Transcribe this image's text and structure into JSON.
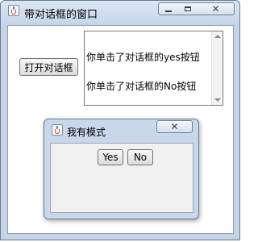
{
  "main_window": {
    "title": "带对话框的窗口",
    "app_icon": "java-cup-icon",
    "controls": {
      "minimize_icon": "minimize-icon",
      "maximize_icon": "maximize-icon",
      "close_icon": "close-icon",
      "close_glyph": "✕"
    },
    "open_dialog_button": "打开对话框",
    "log_lines": [
      "你单击了对话框的yes按钮",
      "你单击了对话框的No按钮"
    ]
  },
  "dialog": {
    "title": "我有模式",
    "app_icon": "java-cup-icon",
    "close_glyph": "✕",
    "yes_label": "Yes",
    "no_label": "No"
  },
  "colors": {
    "window_frame": "#c4d3e6",
    "dialog_frame": "#c8d7ea",
    "client_bg": "#ffffff",
    "dialog_client_bg": "#f0f0f0"
  }
}
